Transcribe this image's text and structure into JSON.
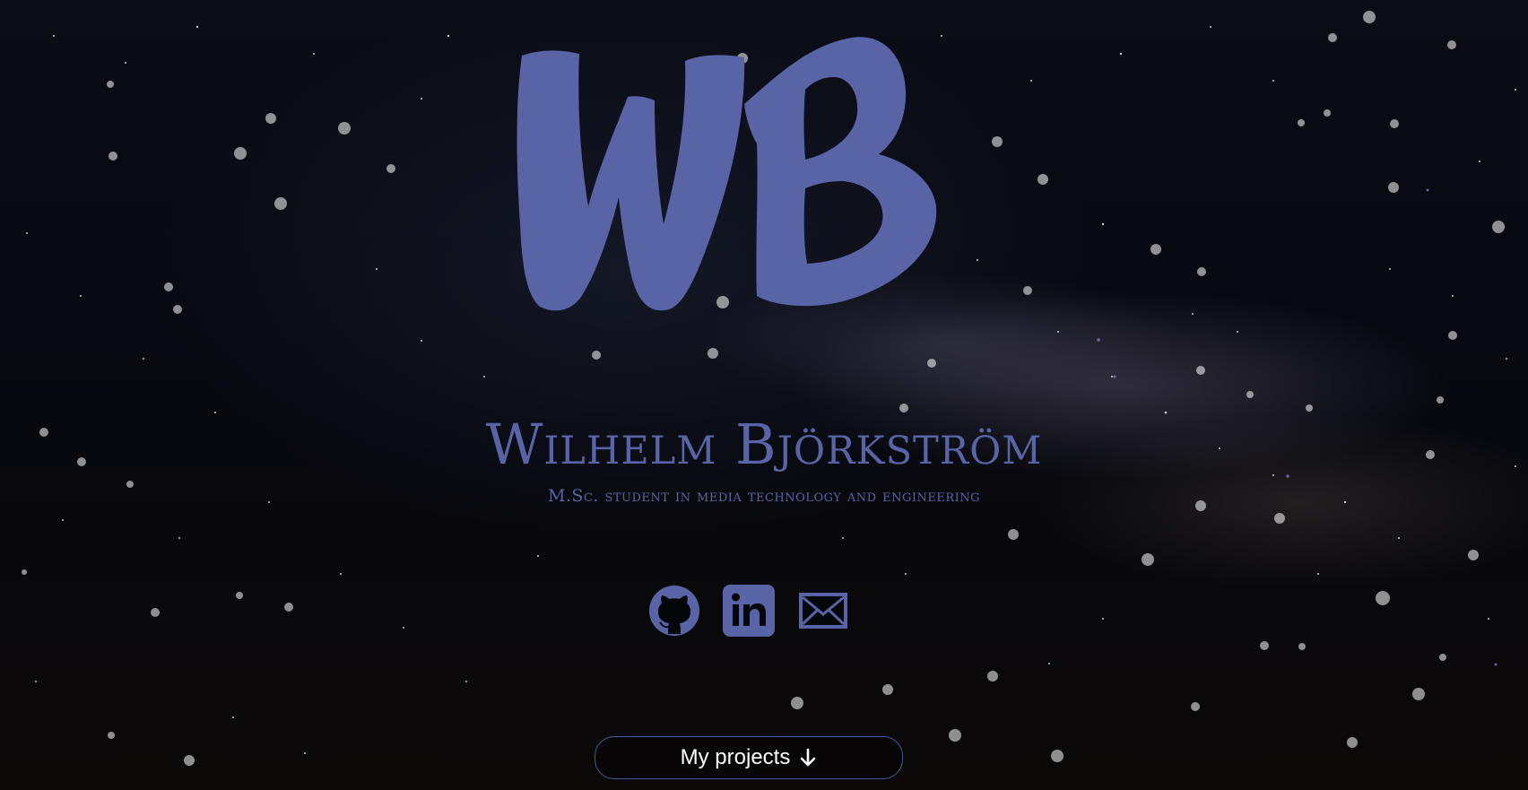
{
  "logo": {
    "text": "WB"
  },
  "hero": {
    "name": "Wilhelm Björkström",
    "subtitle": "M.Sc. student in media technology and engineering"
  },
  "socials": [
    {
      "icon": "github-icon"
    },
    {
      "icon": "linkedin-icon"
    },
    {
      "icon": "mail-icon"
    }
  ],
  "cta": {
    "label": "My projects",
    "icon": "arrow-down-icon"
  },
  "colors": {
    "accent": "#5864a6",
    "background": "#05060a",
    "text": "#ffffff"
  }
}
